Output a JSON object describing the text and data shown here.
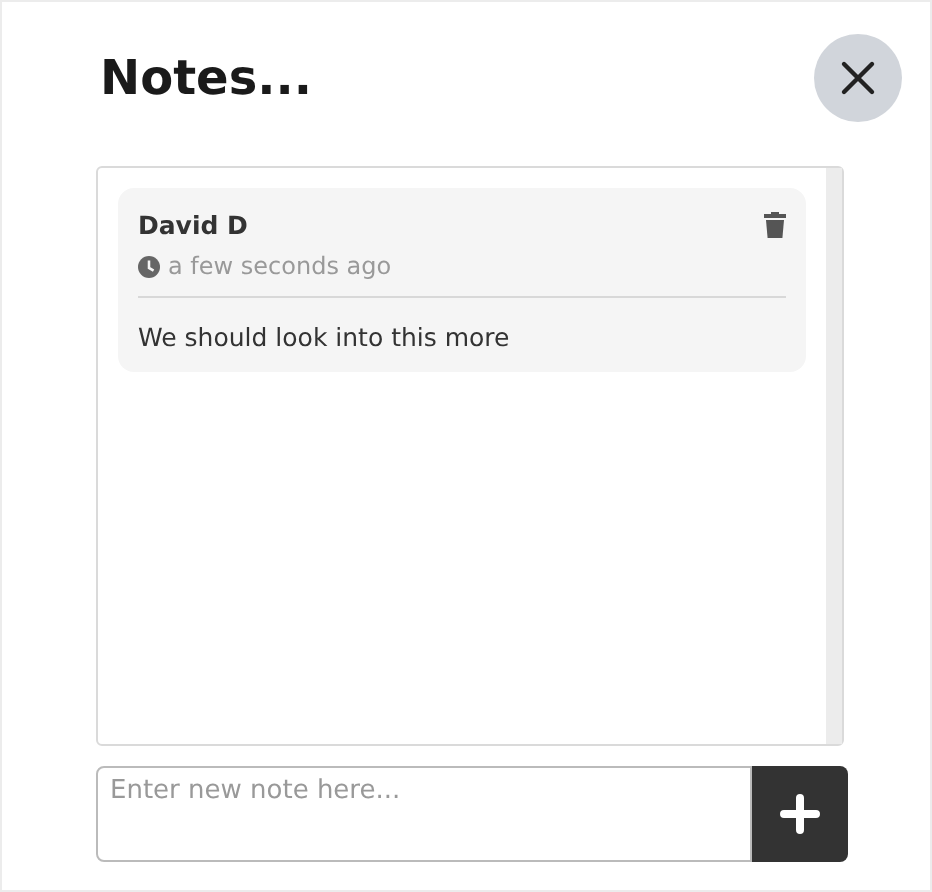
{
  "title": "Notes...",
  "notes": [
    {
      "author": "David D",
      "time": "a few seconds ago",
      "text": "We should look into this more"
    }
  ],
  "input": {
    "placeholder": "Enter new note here..."
  }
}
